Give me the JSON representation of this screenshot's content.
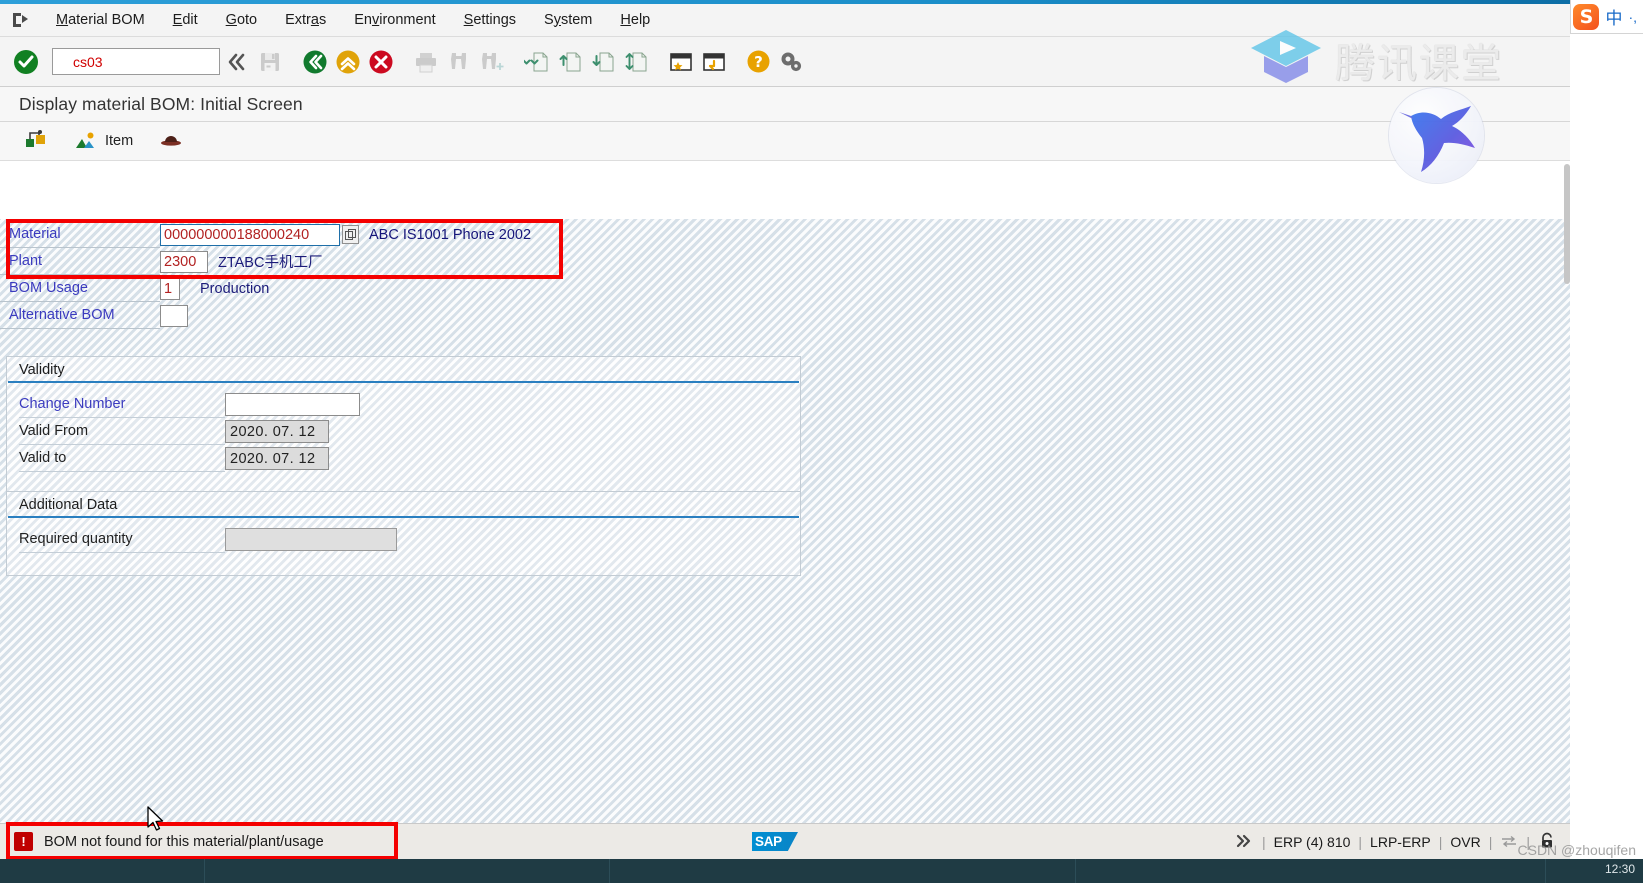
{
  "window": {
    "title": "Display material BOM: Initial Screen"
  },
  "menubar": {
    "icon": "exit-door-icon",
    "items": [
      {
        "label": "Material BOM",
        "accel": "M"
      },
      {
        "label": "Edit",
        "accel": "E"
      },
      {
        "label": "Goto",
        "accel": "G"
      },
      {
        "label": "Extras",
        "accel": "a"
      },
      {
        "label": "Environment",
        "accel": "v"
      },
      {
        "label": "Settings",
        "accel": "S"
      },
      {
        "label": "System",
        "accel": "y"
      },
      {
        "label": "Help",
        "accel": "H"
      }
    ]
  },
  "toolbar": {
    "enter_icon": "green-check-enter-icon",
    "command_value": "cs03",
    "command_placeholder": "",
    "buttons": [
      {
        "name": "command-expand-icon",
        "glyph": "chevrons-left",
        "enabled": true
      },
      {
        "name": "save-icon",
        "glyph": "floppy-disk",
        "enabled": false
      },
      {
        "name": "back-icon",
        "glyph": "green-back",
        "enabled": true
      },
      {
        "name": "exit-icon",
        "glyph": "yellow-up",
        "enabled": true
      },
      {
        "name": "cancel-icon",
        "glyph": "red-x",
        "enabled": true
      },
      {
        "name": "print-icon",
        "glyph": "printer",
        "enabled": false
      },
      {
        "name": "find-icon",
        "glyph": "binoculars",
        "enabled": false
      },
      {
        "name": "find-next-icon",
        "glyph": "binoculars-plus",
        "enabled": false
      },
      {
        "name": "first-page-icon",
        "glyph": "page-first",
        "enabled": true
      },
      {
        "name": "previous-page-icon",
        "glyph": "page-prev",
        "enabled": true
      },
      {
        "name": "next-page-icon",
        "glyph": "page-next",
        "enabled": true
      },
      {
        "name": "last-page-icon",
        "glyph": "page-last",
        "enabled": true
      },
      {
        "name": "create-session-icon",
        "glyph": "window-star",
        "enabled": true
      },
      {
        "name": "create-shortcut-icon",
        "glyph": "window-arrow",
        "enabled": true
      },
      {
        "name": "help-icon",
        "glyph": "question-mark",
        "enabled": true
      },
      {
        "name": "customize-local-layout-icon",
        "glyph": "gears",
        "enabled": true
      }
    ]
  },
  "apptoolbar": {
    "items": [
      {
        "name": "material-bom-button",
        "label": "",
        "icon": "bom-structure-icon"
      },
      {
        "name": "item-button",
        "label": "Item",
        "icon": "item-mountain-icon"
      },
      {
        "name": "header-button",
        "label": "",
        "icon": "header-hat-icon"
      }
    ]
  },
  "header_fields": [
    {
      "name": "material",
      "label": "Material",
      "value": "000000000188000240",
      "description": "ABC IS1001 Phone 2002",
      "has_matchcode": true,
      "focused": true
    },
    {
      "name": "plant",
      "label": "Plant",
      "value": "2300",
      "description": "ZTABC手机工厂",
      "has_matchcode": false,
      "focused": false
    },
    {
      "name": "bom-usage",
      "label": "BOM Usage",
      "value": "1",
      "description": "Production",
      "has_matchcode": false,
      "focused": false
    },
    {
      "name": "alternative-bom",
      "label": "Alternative BOM",
      "value": "",
      "description": "",
      "has_matchcode": false,
      "focused": false
    }
  ],
  "validity_group": {
    "title": "Validity",
    "rows": [
      {
        "name": "change-number",
        "label": "Change Number",
        "value": "",
        "link": true,
        "readonly": false
      },
      {
        "name": "valid-from",
        "label": "Valid From",
        "value": "2020. 07. 12",
        "link": false,
        "readonly": true
      },
      {
        "name": "valid-to",
        "label": "Valid to",
        "value": "2020. 07. 12",
        "link": false,
        "readonly": true
      }
    ]
  },
  "additional_group": {
    "title": "Additional Data",
    "rows": [
      {
        "name": "required-quantity",
        "label": "Required quantity",
        "value": "",
        "link": false,
        "readonly": true
      }
    ]
  },
  "statusbar": {
    "message_icon": "error-exclamation-icon",
    "message": "BOM not found for this material/plant/usage",
    "logo": "SAP",
    "expand_icon": "chevrons-right",
    "segments": [
      "ERP (4) 810",
      "LRP-ERP",
      "OVR"
    ],
    "insert_mode_icon": "insert-mode-icon",
    "lock_icon": "lock-icon"
  },
  "watermarks": {
    "tencent_text": "腾讯课堂",
    "tencent_icon": "tencent-classroom-play-icon",
    "bird_icon": "hummingbird-icon",
    "csdn": "CSDN @zhouqifen"
  },
  "ime": {
    "logo": "sogou-s-icon",
    "mode": "中",
    "punct": "·,"
  },
  "taskbar": {
    "clock": "12:30"
  },
  "colors": {
    "accent_blue": "#2a7fc0",
    "label_blue": "#3b3bbf",
    "value_red": "#b22222",
    "error_red": "#c00000",
    "annotation_red": "#f40000",
    "sap_blue": "#008fd3"
  }
}
